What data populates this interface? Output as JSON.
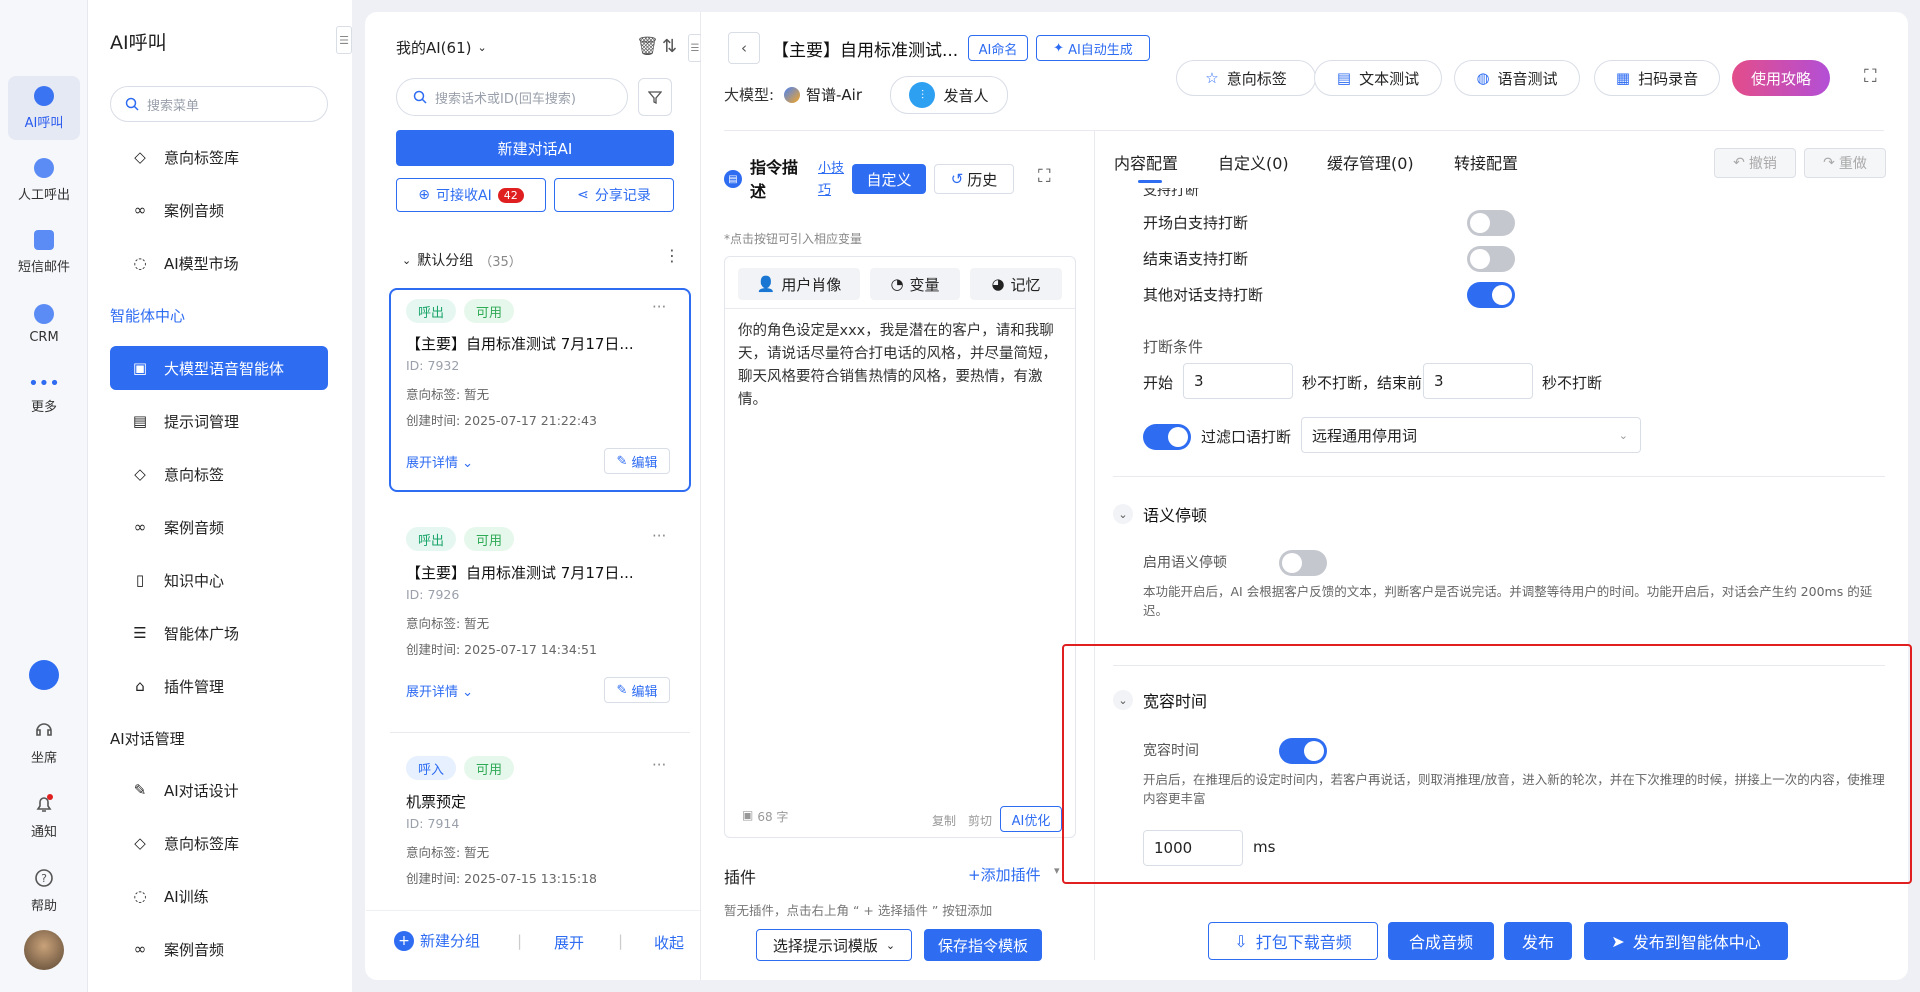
{
  "rail": {
    "items": [
      {
        "label": "AI呼叫",
        "active": true
      },
      {
        "label": "人工呼出"
      },
      {
        "label": "短信邮件"
      },
      {
        "label": "CRM"
      },
      {
        "label": "更多"
      }
    ],
    "bottom": [
      {
        "label": "坐席"
      },
      {
        "label": "通知"
      },
      {
        "label": "帮助"
      }
    ]
  },
  "menu": {
    "title": "AI呼叫",
    "search_placeholder": "搜索菜单",
    "top_items": [
      "意向标签库",
      "案例音频",
      "AI模型市场"
    ],
    "section1": "智能体中心",
    "section1_items": [
      "大模型语音智能体",
      "提示词管理",
      "意向标签",
      "案例音频",
      "知识中心",
      "智能体广场",
      "插件管理"
    ],
    "section2": "AI对话管理",
    "section2_items": [
      "AI对话设计",
      "意向标签库",
      "AI训练",
      "案例音频"
    ]
  },
  "list": {
    "header": "我的AI(61)",
    "search_placeholder": "搜索话术或ID(回车搜索)",
    "new_button": "新建对话AI",
    "receivable_label": "可接收AI",
    "receivable_count": "42",
    "share_label": "分享记录",
    "group_name": "默认分组",
    "group_count": "（35）",
    "cards": [
      {
        "tags": [
          "呼出",
          "可用"
        ],
        "title": "【主要】自用标准测试 7月17日...",
        "id": "ID: 7932",
        "intent": "意向标签: 暂无",
        "created": "创建时间: 2025-07-17 21:22:43",
        "expand": "展开详情",
        "edit": "编辑"
      },
      {
        "tags": [
          "呼出",
          "可用"
        ],
        "title": "【主要】自用标准测试 7月17日...",
        "id": "ID: 7926",
        "intent": "意向标签: 暂无",
        "created": "创建时间: 2025-07-17 14:34:51",
        "expand": "展开详情",
        "edit": "编辑"
      },
      {
        "tags": [
          "呼入",
          "可用"
        ],
        "title": "机票预定",
        "id": "ID: 7914",
        "intent": "意向标签: 暂无",
        "created": "创建时间: 2025-07-15 13:15:18",
        "expand": "展开详情",
        "edit": "编辑"
      }
    ],
    "footer": {
      "new_group": "新建分组",
      "expand": "展开",
      "collapse": "收起"
    }
  },
  "header": {
    "title": "【主要】自用标准测试...",
    "ai_name_btn": "AI命名",
    "ai_auto_btn": "AI自动生成",
    "model_label": "大模型:",
    "model_name": "智谱-Air",
    "speaker_btn": "发音人",
    "actions": [
      "意向标签",
      "文本测试",
      "语音测试",
      "扫码录音"
    ],
    "guide_btn": "使用攻略"
  },
  "instruction": {
    "title_line1": "指令描",
    "title_line2": "述",
    "tip_line1": "小技",
    "tip_line2": "巧",
    "custom_btn": "自定义",
    "history_btn": "历史",
    "hint": "*点击按钮可引入相应变量",
    "var_buttons": [
      "用户肖像",
      "变量",
      "记忆"
    ],
    "text": "你的角色设定是xxx，我是潜在的客户，请和我聊天，请说话尽量符合打电话的风格，并尽量简短，聊天风格要符合销售热情的风格，要热情，有激情。",
    "char_count": "68 字",
    "copy": "复制",
    "cut": "剪切",
    "ai_optimize": "AI优化",
    "plugin_title": "插件",
    "add_plugin": "+添加插件",
    "plugin_empty": "暂无插件，点击右上角 “ + 选择插件 ” 按钮添加",
    "select_template": "选择提示词模版",
    "save_template": "保存指令模板"
  },
  "config": {
    "tabs": [
      "内容配置",
      "自定义(0)",
      "缓存管理(0)",
      "转接配置"
    ],
    "undo": "撤销",
    "redo": "重做",
    "cut_off_text": "支持打断",
    "interrupts": [
      {
        "label": "开场白支持打断",
        "on": false
      },
      {
        "label": "结束语支持打断",
        "on": false
      },
      {
        "label": "其他对话支持打断",
        "on": true
      }
    ],
    "condition_title": "打断条件",
    "cond_start": "开始",
    "cond_start_val": "3",
    "cond_mid": "秒不打断，结束前",
    "cond_end_val": "3",
    "cond_end": "秒不打断",
    "filter_label": "过滤口语打断",
    "filter_on": true,
    "filter_select": "远程通用停用词",
    "semantic_title": "语义停顿",
    "semantic_label": "启用语义停顿",
    "semantic_on": false,
    "semantic_desc": "本功能开启后，AI 会根据客户反馈的文本，判断客户是否说完话。并调整等待用户的时间。功能开启后，对话会产生约 200ms 的延迟。",
    "tolerance_title": "宽容时间",
    "tolerance_label": "宽容时间",
    "tolerance_on": true,
    "tolerance_desc": "开启后，在推理后的设定时间内，若客户再说话，则取消推理/放音，进入新的轮次，并在下次推理的时候，拼接上一次的内容，使推理内容更丰富",
    "tolerance_value": "1000",
    "tolerance_unit": "ms"
  },
  "footer_actions": {
    "download": "打包下载音频",
    "synth": "合成音频",
    "publish": "发布",
    "publish_center": "发布到智能体中心"
  },
  "colors": {
    "accent": "#2e6cf2",
    "highlight": "#e02020",
    "guide": "#c94fc4"
  }
}
